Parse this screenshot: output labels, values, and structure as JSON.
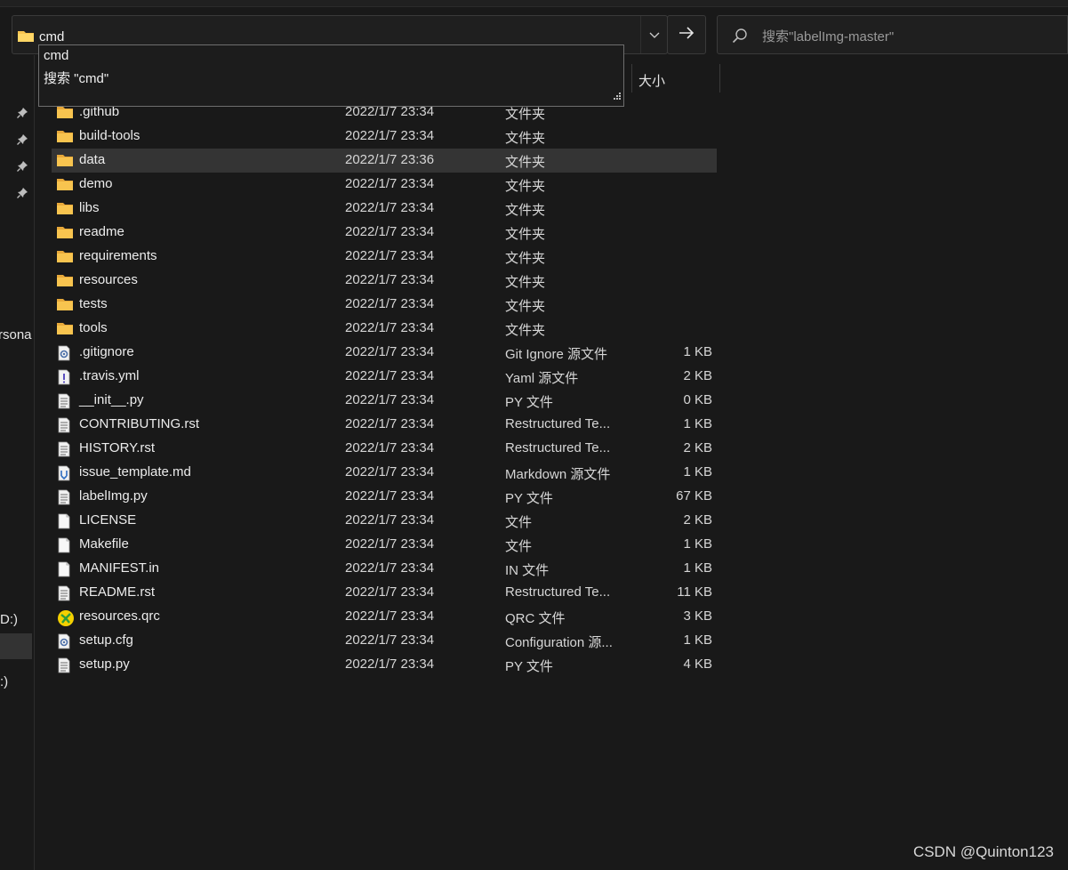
{
  "address_bar": {
    "value": "cmd",
    "placeholder": ""
  },
  "search": {
    "placeholder": "搜索\"labelImg-master\""
  },
  "autocomplete": {
    "items": [
      "cmd",
      "搜索 \"cmd\""
    ]
  },
  "columns": {
    "size": "大小"
  },
  "nav": {
    "labels": [
      "rsona",
      "D:)",
      ":)"
    ]
  },
  "files": [
    {
      "name": ".github",
      "date": "2022/1/7 23:34",
      "type": "文件夹",
      "size": "",
      "icon": "folder-icon"
    },
    {
      "name": "build-tools",
      "date": "2022/1/7 23:34",
      "type": "文件夹",
      "size": "",
      "icon": "folder-icon"
    },
    {
      "name": "data",
      "date": "2022/1/7 23:36",
      "type": "文件夹",
      "size": "",
      "icon": "folder-icon"
    },
    {
      "name": "demo",
      "date": "2022/1/7 23:34",
      "type": "文件夹",
      "size": "",
      "icon": "folder-icon"
    },
    {
      "name": "libs",
      "date": "2022/1/7 23:34",
      "type": "文件夹",
      "size": "",
      "icon": "folder-icon"
    },
    {
      "name": "readme",
      "date": "2022/1/7 23:34",
      "type": "文件夹",
      "size": "",
      "icon": "folder-icon"
    },
    {
      "name": "requirements",
      "date": "2022/1/7 23:34",
      "type": "文件夹",
      "size": "",
      "icon": "folder-icon"
    },
    {
      "name": "resources",
      "date": "2022/1/7 23:34",
      "type": "文件夹",
      "size": "",
      "icon": "folder-icon"
    },
    {
      "name": "tests",
      "date": "2022/1/7 23:34",
      "type": "文件夹",
      "size": "",
      "icon": "folder-icon"
    },
    {
      "name": "tools",
      "date": "2022/1/7 23:34",
      "type": "文件夹",
      "size": "",
      "icon": "folder-icon"
    },
    {
      "name": ".gitignore",
      "date": "2022/1/7 23:34",
      "type": "Git Ignore 源文件",
      "size": "1 KB",
      "icon": "config-file-icon"
    },
    {
      "name": ".travis.yml",
      "date": "2022/1/7 23:34",
      "type": "Yaml 源文件",
      "size": "2 KB",
      "icon": "yaml-file-icon"
    },
    {
      "name": "__init__.py",
      "date": "2022/1/7 23:34",
      "type": "PY 文件",
      "size": "0 KB",
      "icon": "text-file-icon"
    },
    {
      "name": "CONTRIBUTING.rst",
      "date": "2022/1/7 23:34",
      "type": "Restructured Te...",
      "size": "1 KB",
      "icon": "text-file-icon"
    },
    {
      "name": "HISTORY.rst",
      "date": "2022/1/7 23:34",
      "type": "Restructured Te...",
      "size": "2 KB",
      "icon": "text-file-icon"
    },
    {
      "name": "issue_template.md",
      "date": "2022/1/7 23:34",
      "type": "Markdown 源文件",
      "size": "1 KB",
      "icon": "markdown-file-icon"
    },
    {
      "name": "labelImg.py",
      "date": "2022/1/7 23:34",
      "type": "PY 文件",
      "size": "67 KB",
      "icon": "text-file-icon"
    },
    {
      "name": "LICENSE",
      "date": "2022/1/7 23:34",
      "type": "文件",
      "size": "2 KB",
      "icon": "blank-file-icon"
    },
    {
      "name": "Makefile",
      "date": "2022/1/7 23:34",
      "type": "文件",
      "size": "1 KB",
      "icon": "blank-file-icon"
    },
    {
      "name": "MANIFEST.in",
      "date": "2022/1/7 23:34",
      "type": "IN 文件",
      "size": "1 KB",
      "icon": "blank-file-icon"
    },
    {
      "name": "README.rst",
      "date": "2022/1/7 23:34",
      "type": "Restructured Te...",
      "size": "11 KB",
      "icon": "text-file-icon"
    },
    {
      "name": "resources.qrc",
      "date": "2022/1/7 23:34",
      "type": "QRC 文件",
      "size": "3 KB",
      "icon": "qrc-file-icon"
    },
    {
      "name": "setup.cfg",
      "date": "2022/1/7 23:34",
      "type": "Configuration 源...",
      "size": "1 KB",
      "icon": "config-file-icon"
    },
    {
      "name": "setup.py",
      "date": "2022/1/7 23:34",
      "type": "PY 文件",
      "size": "4 KB",
      "icon": "text-file-icon"
    }
  ],
  "selected_file": "data",
  "watermark": "CSDN @Quinton123",
  "colors": {
    "background": "#191919",
    "folder": "#f8c44f",
    "selection": "#343434",
    "border": "#3a3a3a"
  }
}
